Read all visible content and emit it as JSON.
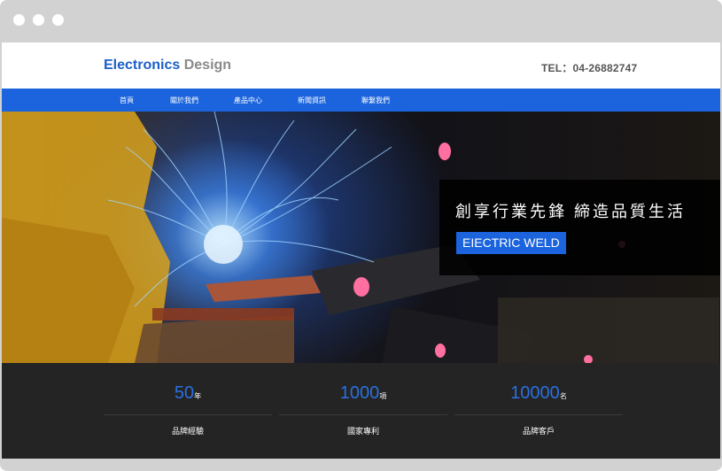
{
  "header": {
    "logo_primary": "Electronics",
    "logo_secondary": "Design",
    "tel": "TEL：04-26882747"
  },
  "nav": {
    "items": [
      "首頁",
      "關於我們",
      "產品中心",
      "新聞資訊",
      "聯繫我們"
    ]
  },
  "hero": {
    "slogan": "創享行業先鋒 締造品質生活",
    "tagline": "EIECTRIC WELD"
  },
  "stats": [
    {
      "value": "50",
      "unit": "年",
      "label": "品牌經驗"
    },
    {
      "value": "1000",
      "unit": "項",
      "label": "國家專利"
    },
    {
      "value": "10000",
      "unit": "名",
      "label": "品牌客戶"
    }
  ],
  "colors": {
    "brand_blue": "#1b64dd",
    "stats_background": "#242424",
    "window_chrome": "#d2d2d2"
  }
}
